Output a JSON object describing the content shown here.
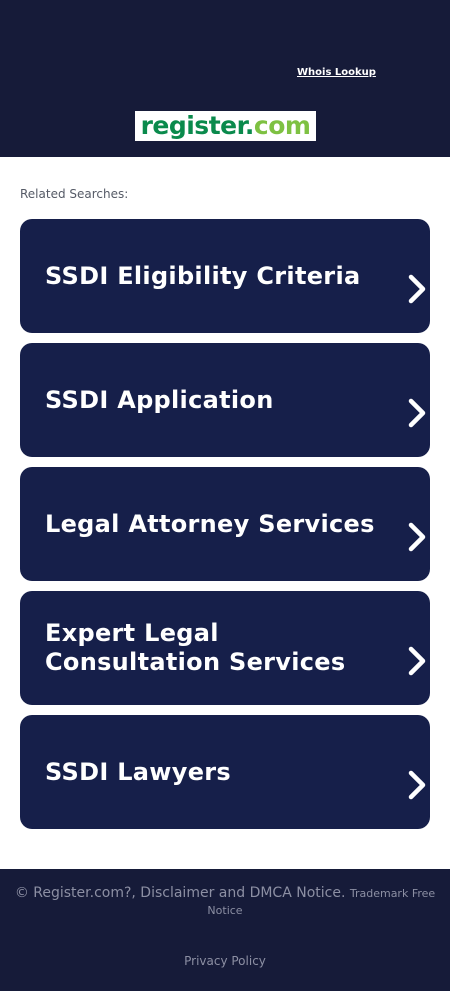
{
  "header": {
    "whois_link": "Whois Lookup",
    "logo": {
      "main": "register",
      "dot": ".",
      "tld": "com"
    }
  },
  "related": {
    "label": "Related Searches:",
    "items": [
      {
        "label": "SSDI Eligibility Criteria"
      },
      {
        "label": "SSDI Application"
      },
      {
        "label": "Legal Attorney Services"
      },
      {
        "label": "Expert Legal Consultation Services"
      },
      {
        "label": "SSDI Lawyers"
      }
    ],
    "chevron_icon": "chevron-right-icon"
  },
  "footer": {
    "notice": "© Register.com?, Disclaimer and DMCA Notice.",
    "trademark": "Trademark Free Notice",
    "privacy": "Privacy Policy"
  },
  "colors": {
    "header_bg": "#161b39",
    "card_bg": "#161f4a",
    "brand_green": "#0a8a4c",
    "brand_lime": "#7ec142"
  }
}
